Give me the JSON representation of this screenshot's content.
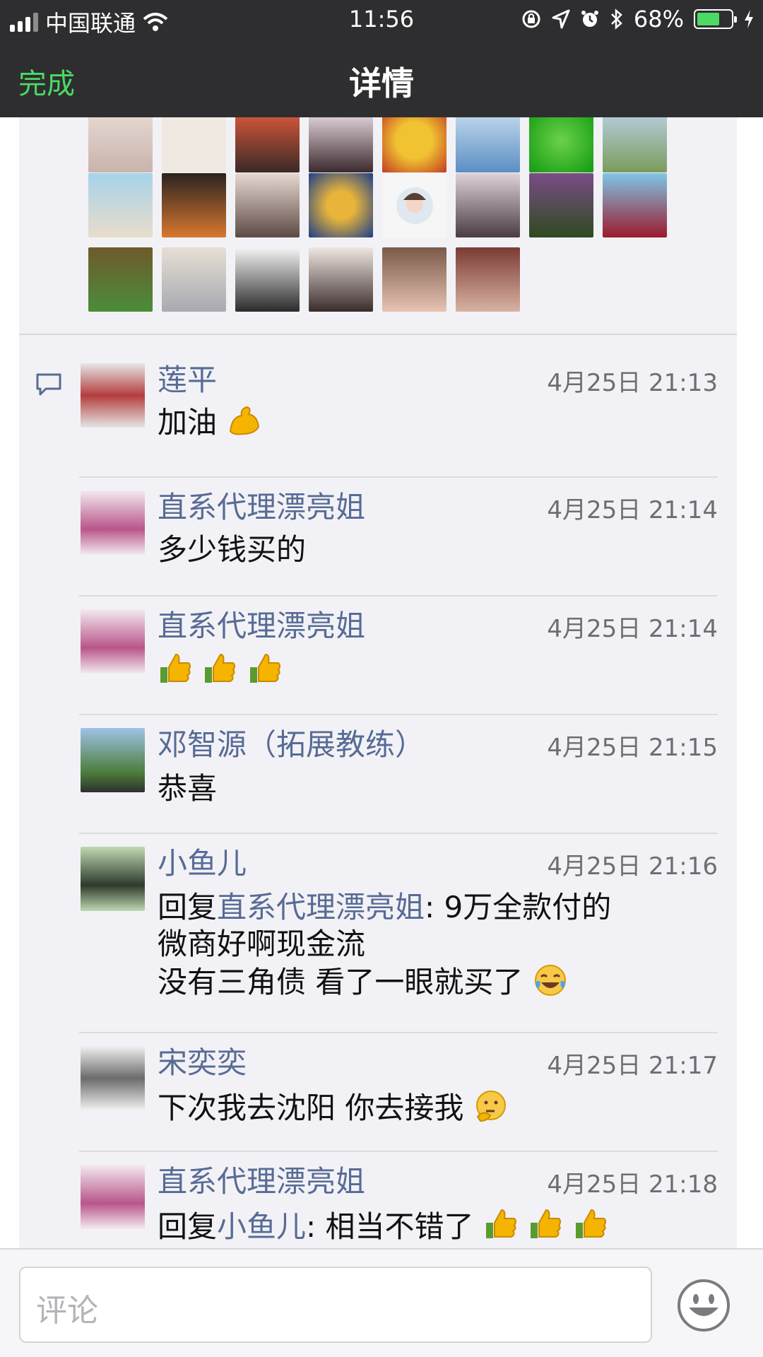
{
  "status_bar": {
    "carrier": "中国联通",
    "time": "11:56",
    "battery": "68%",
    "battery_level": 0.68
  },
  "nav": {
    "done_label": "完成",
    "title": "详情"
  },
  "comments": [
    {
      "name": "莲平",
      "time": "4月25日 21:13",
      "text": "加油",
      "emoji": [
        "flexed-biceps"
      ]
    },
    {
      "name": "直系代理漂亮姐",
      "time": "4月25日 21:14",
      "text": "多少钱买的"
    },
    {
      "name": "直系代理漂亮姐",
      "time": "4月25日 21:14",
      "text": "",
      "emoji": [
        "thumbs-up",
        "thumbs-up",
        "thumbs-up"
      ]
    },
    {
      "name": "邓智源（拓展教练）",
      "time": "4月25日 21:15",
      "text": "恭喜"
    },
    {
      "name": "小鱼儿",
      "time": "4月25日 21:16",
      "reply_prefix": "回复",
      "reply_to": "直系代理漂亮姐",
      "text_line1": ": 9万全款付的",
      "text_line2": "微商好啊现金流",
      "text_line3": "没有三角债 看了一眼就买了",
      "emoji": [
        "tears-of-joy"
      ]
    },
    {
      "name": "宋奕奕",
      "time": "4月25日 21:17",
      "text": "下次我去沈阳 你去接我",
      "emoji": [
        "thinking"
      ]
    },
    {
      "name": "直系代理漂亮姐",
      "time": "4月25日 21:18",
      "reply_prefix": "回复",
      "reply_to": "小鱼儿",
      "text": ": 相当不错了",
      "emoji": [
        "thumbs-up",
        "thumbs-up",
        "thumbs-up"
      ]
    }
  ],
  "footer": {
    "input_placeholder": "评论"
  },
  "colors": {
    "header_bg": "#2e2e30",
    "accent_green": "#4cd964",
    "name_blue": "#576b95",
    "content_bg": "#f2f2f6"
  }
}
